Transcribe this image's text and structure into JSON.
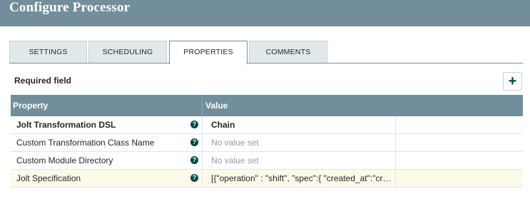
{
  "header": {
    "title": "Configure Processor"
  },
  "tabs": [
    {
      "label": "SETTINGS",
      "active": false
    },
    {
      "label": "SCHEDULING",
      "active": false
    },
    {
      "label": "PROPERTIES",
      "active": true
    },
    {
      "label": "COMMENTS",
      "active": false
    }
  ],
  "properties": {
    "required_label": "Required field",
    "add_icon": "plus-icon",
    "columns": {
      "property": "Property",
      "value": "Value"
    },
    "rows": [
      {
        "name": "Jolt Transformation DSL",
        "value": "Chain",
        "help_icon": "?"
      },
      {
        "name": "Custom Transformation Class Name",
        "value": "No value set",
        "help_icon": "?"
      },
      {
        "name": "Custom Module Directory",
        "value": "No value set",
        "help_icon": "?"
      },
      {
        "name": "Jolt Specification",
        "value": "[{\"operation\" : \"shift\", \"spec\":{ \"created_at\":\"created_at\", \"id\":\"id\", \"text\":\"text\" }}]",
        "help_icon": "?"
      }
    ]
  },
  "colors": {
    "header": "#728e9b",
    "help_icon": "#004849",
    "highlight_row": "#fdfaea"
  }
}
